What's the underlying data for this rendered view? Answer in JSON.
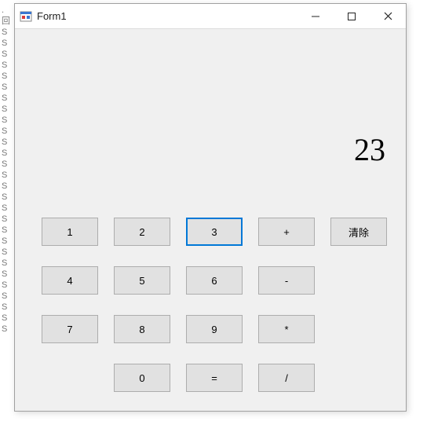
{
  "gutter": [
    ".",
    "",
    "",
    "",
    "",
    "回",
    "",
    "S",
    "S",
    "S",
    "S",
    "S",
    "S",
    "S",
    "S",
    "S",
    "S",
    "S",
    "S",
    "S",
    "S",
    "S",
    "S",
    "S",
    "S",
    "S",
    "S",
    "S",
    "S",
    "S",
    "S",
    "S",
    "S",
    "S",
    "S"
  ],
  "window": {
    "title": "Form1"
  },
  "calculator": {
    "display": "23",
    "buttons": {
      "b1": "1",
      "b2": "2",
      "b3": "3",
      "add": "+",
      "clear": "清除",
      "b4": "4",
      "b5": "5",
      "b6": "6",
      "sub": "-",
      "b7": "7",
      "b8": "8",
      "b9": "9",
      "mul": "*",
      "b0": "0",
      "eq": "=",
      "div": "/"
    }
  }
}
